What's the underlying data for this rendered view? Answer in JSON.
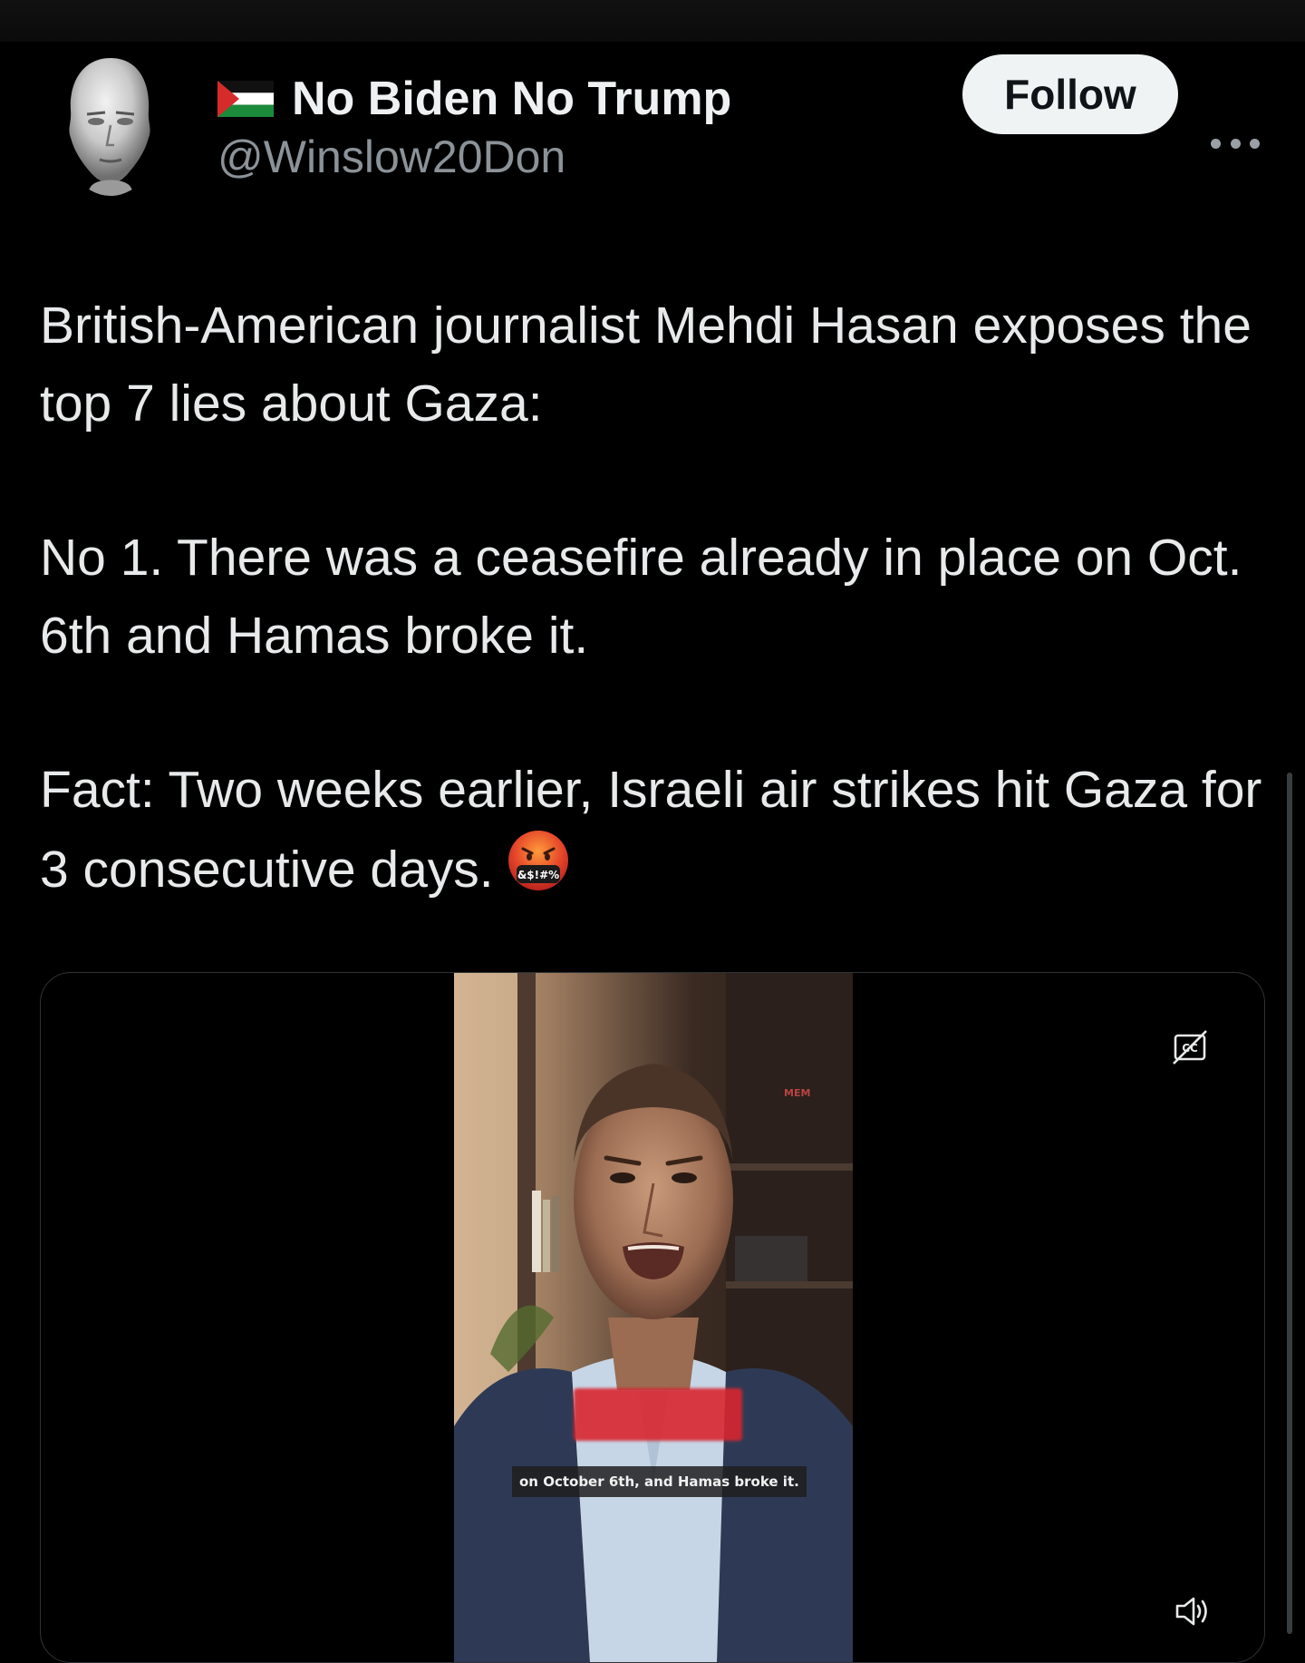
{
  "account": {
    "display_name": "No Biden No Trump",
    "handle": "@Winslow20Don",
    "flag_icon": "palestine-flag-icon",
    "avatar_icon": "avatar-face"
  },
  "actions": {
    "follow_label": "Follow",
    "more_icon": "more-dots-icon"
  },
  "tweet": {
    "paragraphs": [
      "British-American journalist Mehdi Hasan exposes the top 7 lies about Gaza:",
      "No 1. There was a ceasefire already in place on Oct. 6th and Hamas broke it.",
      "Fact: Two weeks earlier, Israeli air strikes hit Gaza for 3 consecutive days."
    ],
    "emoji": "face-with-symbols-on-mouth",
    "emoji_text": "&$!#%"
  },
  "media": {
    "caption": "on October 6th, and Hamas broke it.",
    "watermark": "MEM",
    "cc_icon": "closed-captions-icon",
    "volume_icon": "volume-icon"
  },
  "colors": {
    "background": "#000000",
    "text": "#e7e9ea",
    "secondary_text": "#8b9298",
    "follow_bg": "#eff3f4",
    "border": "#2f3336"
  }
}
